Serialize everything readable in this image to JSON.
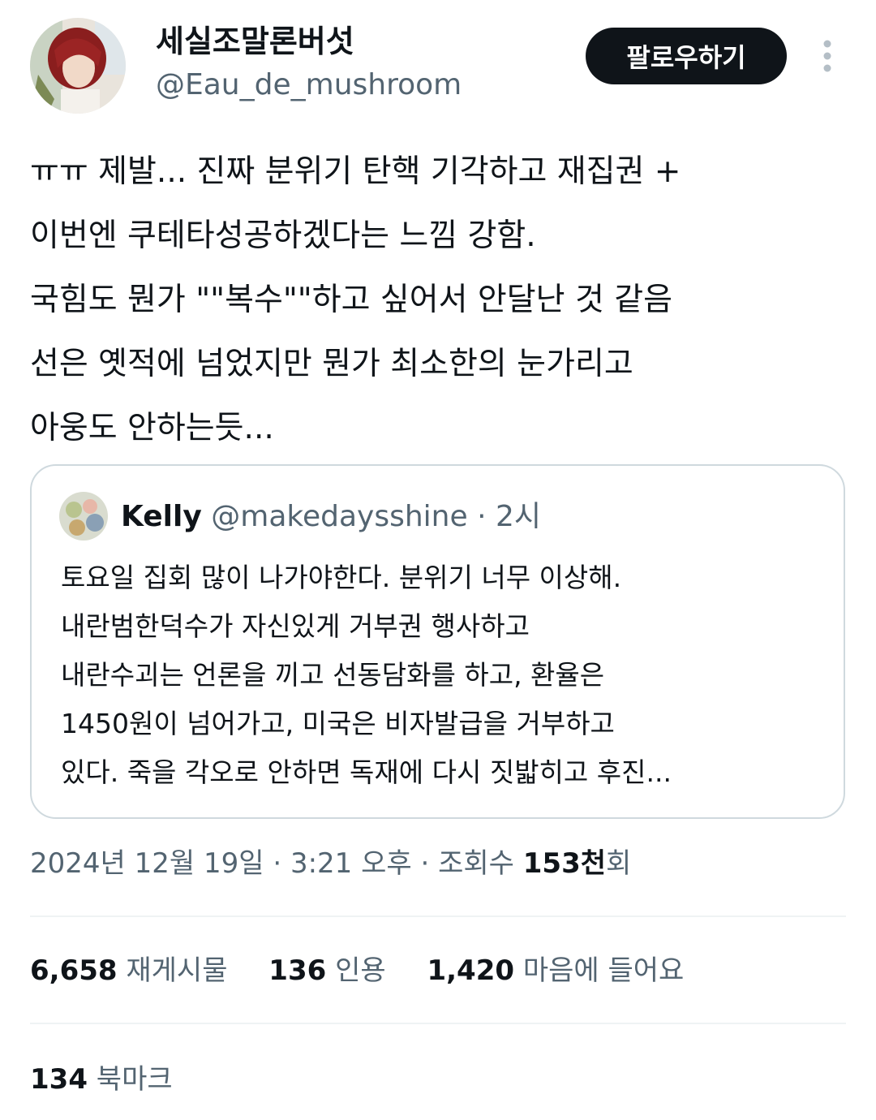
{
  "author": {
    "display_name": "세실조말론버섯",
    "handle": "@Eau_de_mushroom"
  },
  "follow_button": {
    "label": "팔로우하기"
  },
  "tweet": {
    "lines": [
      "ㅠㅠ 제발... 진짜 분위기 탄핵 기각하고 재집권 +",
      "이번엔 쿠테타성공하겠다는 느낌 강함.",
      "국힘도 뭔가 \"\"복수\"\"하고 싶어서 안달난 것 같음",
      "선은 옛적에 넘었지만 뭔가 최소한의 눈가리고",
      "아웅도 안하는듯..."
    ]
  },
  "quote": {
    "name": "Kelly",
    "handle": "@makedaysshine",
    "separator": " · ",
    "time": "2시",
    "lines": [
      "토요일 집회 많이 나가야한다. 분위기 너무 이상해.",
      "내란범한덕수가 자신있게 거부권 행사하고",
      "내란수괴는 언론을 끼고 선동담화를 하고, 환율은",
      "1450원이 넘어가고, 미국은 비자발급을 거부하고",
      "있다. 죽을 각오로 안하면 독재에 다시 짓밟히고 후진..."
    ]
  },
  "meta": {
    "date": "2024년 12월 19일",
    "separator": " · ",
    "time": "3:21 오후",
    "views_label": "조회수 ",
    "views_count": "153천",
    "views_suffix": "회"
  },
  "stats": {
    "retweets_count": "6,658",
    "retweets_label": "재게시물",
    "quotes_count": "136",
    "quotes_label": "인용",
    "likes_count": "1,420",
    "likes_label": "마음에 들어요",
    "bookmarks_count": "134",
    "bookmarks_label": "북마크"
  },
  "colors": {
    "text_primary": "#0f1419",
    "text_secondary": "#536471",
    "border": "#cfd9de",
    "divider": "#eff3f4",
    "button_bg": "#0f1419"
  }
}
